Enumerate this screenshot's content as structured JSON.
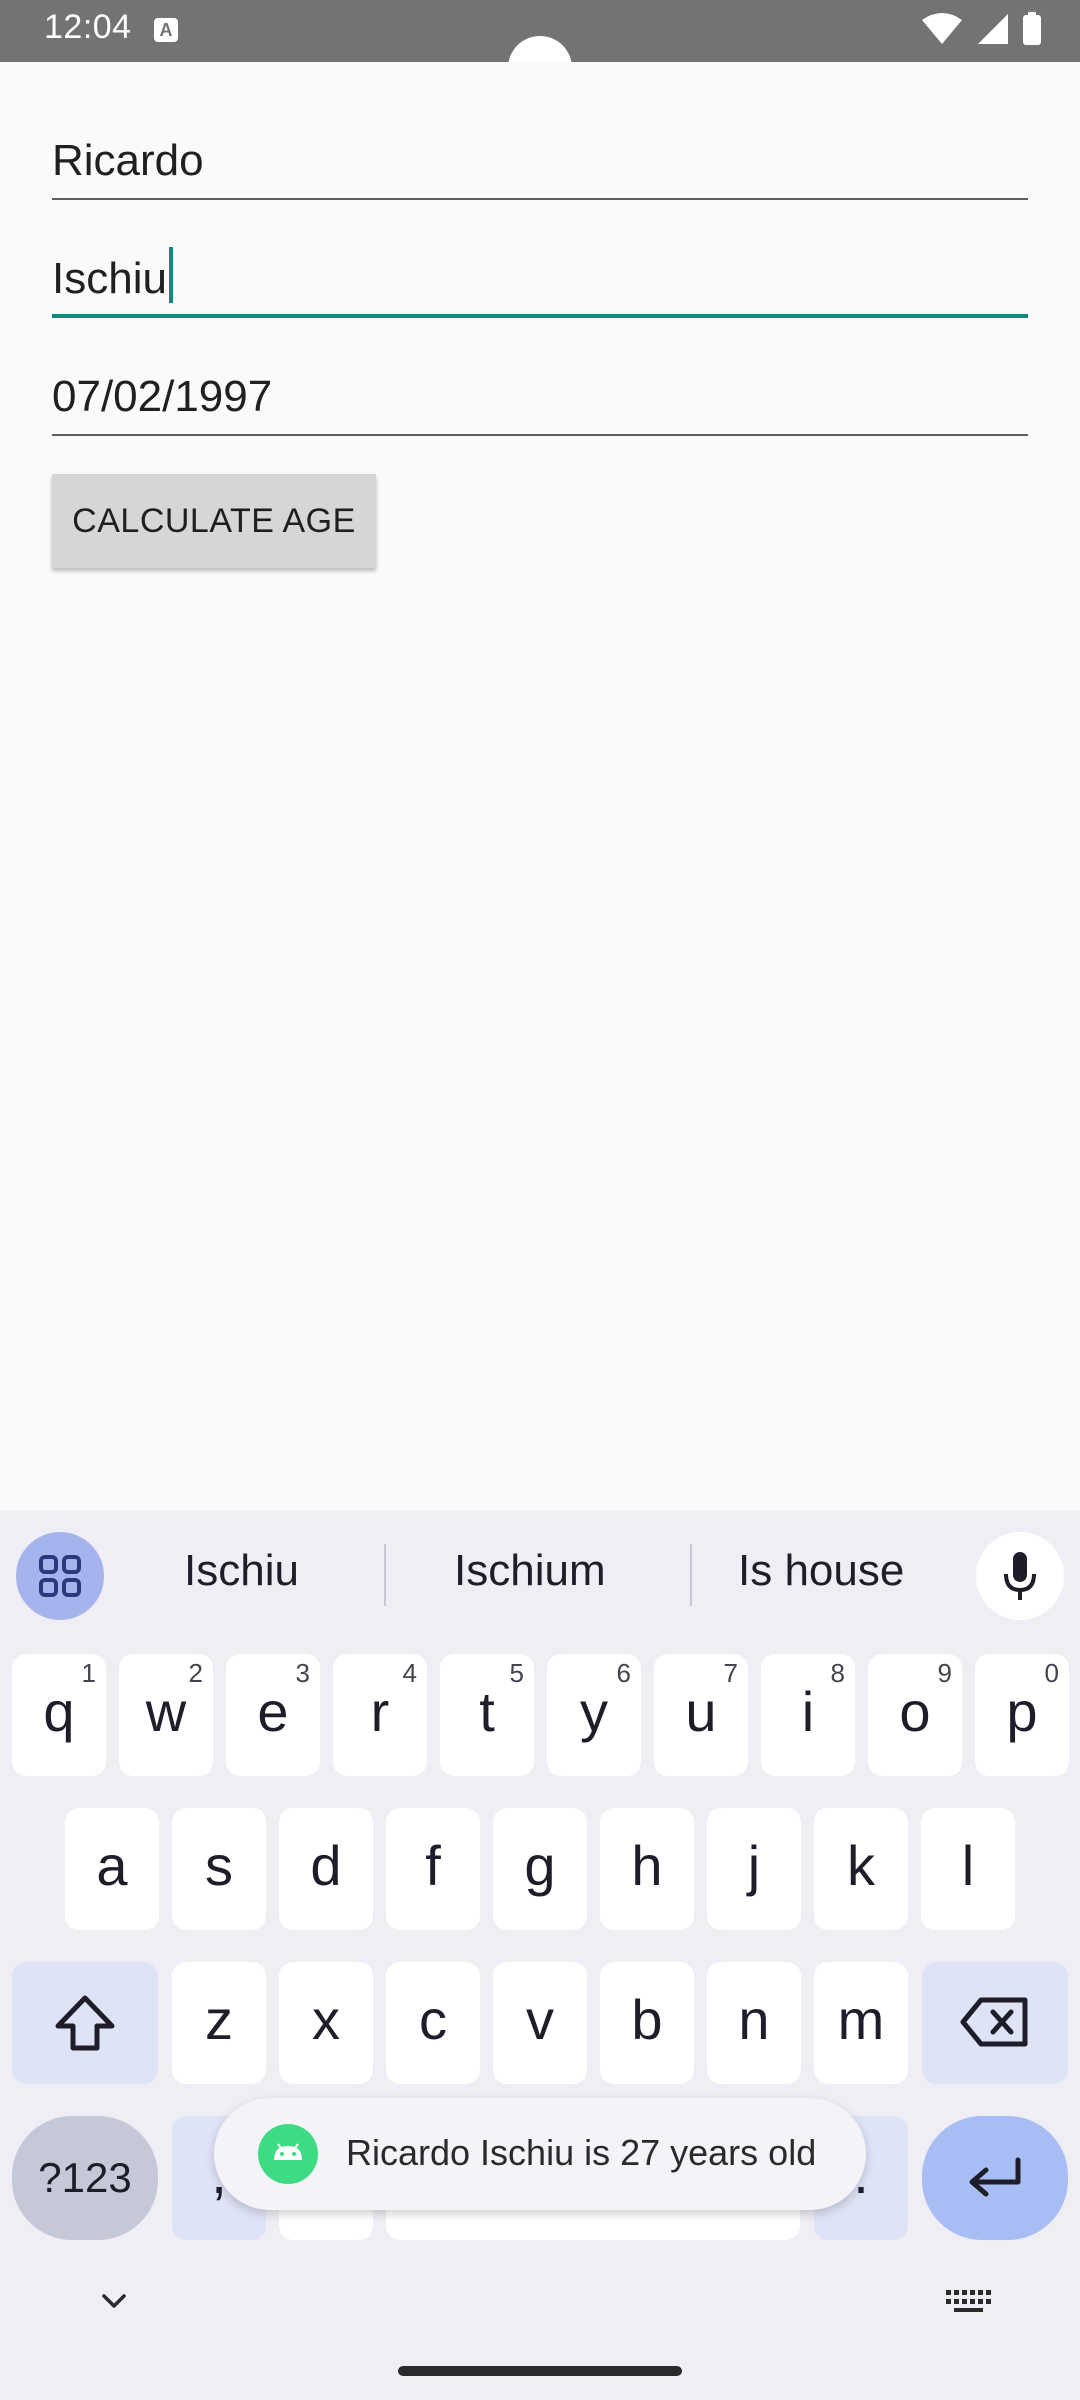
{
  "status_bar": {
    "time": "12:04",
    "badge": "A"
  },
  "form": {
    "first_name": "Ricardo",
    "last_name": "Ischiu",
    "birth_date": "07/02/1997",
    "calculate_label": "CALCULATE AGE"
  },
  "keyboard": {
    "suggestions": [
      "Ischiu",
      "Ischium",
      "Is house"
    ],
    "row1": [
      {
        "k": "q",
        "h": "1"
      },
      {
        "k": "w",
        "h": "2"
      },
      {
        "k": "e",
        "h": "3"
      },
      {
        "k": "r",
        "h": "4"
      },
      {
        "k": "t",
        "h": "5"
      },
      {
        "k": "y",
        "h": "6"
      },
      {
        "k": "u",
        "h": "7"
      },
      {
        "k": "i",
        "h": "8"
      },
      {
        "k": "o",
        "h": "9"
      },
      {
        "k": "p",
        "h": "0"
      }
    ],
    "row2": [
      "a",
      "s",
      "d",
      "f",
      "g",
      "h",
      "j",
      "k",
      "l"
    ],
    "row3": [
      "z",
      "x",
      "c",
      "v",
      "b",
      "n",
      "m"
    ],
    "symbols_label": "?123",
    "comma": ",",
    "period": "."
  },
  "toast": {
    "message": "Ricardo Ischiu is 27 years old"
  },
  "colors": {
    "accent": "#138a7d",
    "enter_key": "#a9bdf5",
    "status_bar": "#737373"
  }
}
